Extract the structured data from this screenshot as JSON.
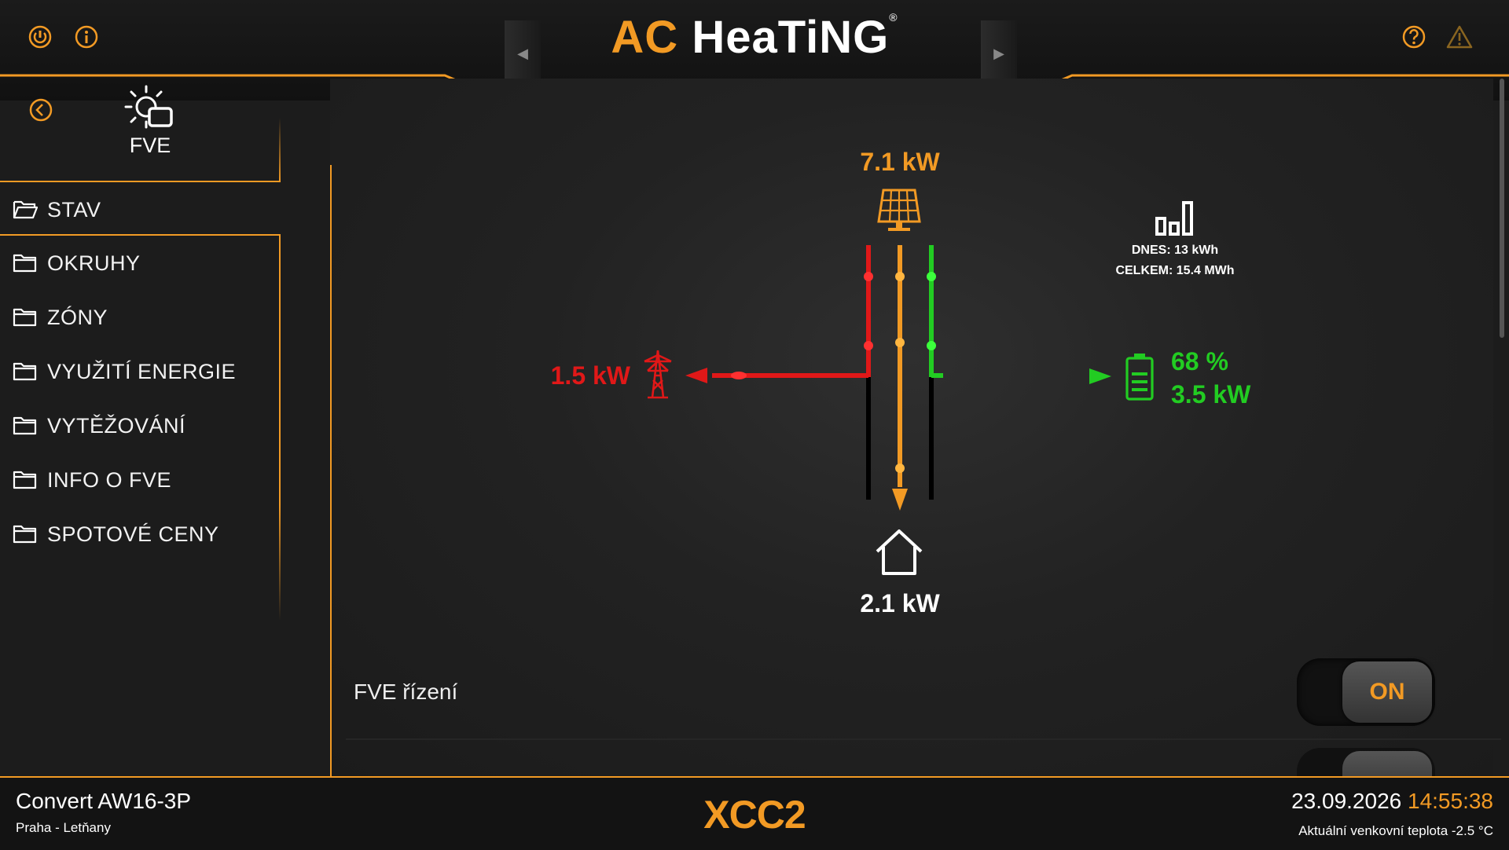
{
  "header": {
    "brand_ac": "AC",
    "brand_heating": "HeaTiNG",
    "brand_reg": "®",
    "prev_arrow": "◀",
    "next_arrow": "▶"
  },
  "sidebar": {
    "page_title": "FVE",
    "items": [
      {
        "label": "STAV"
      },
      {
        "label": "OKRUHY"
      },
      {
        "label": "ZÓNY"
      },
      {
        "label": "VYUŽITÍ ENERGIE"
      },
      {
        "label": "VYTĚŽOVÁNÍ"
      },
      {
        "label": "INFO O FVE"
      },
      {
        "label": "SPOTOVÉ CENY"
      }
    ]
  },
  "energy_flow": {
    "solar_power": "7.1 kW",
    "grid_power": "1.5 kW",
    "battery_percent": "68 %",
    "battery_power": "3.5 kW",
    "house_power": "2.1 kW",
    "stats_today": "DNES: 13 kWh",
    "stats_total": "CELKEM: 15.4 MWh"
  },
  "controls": {
    "fve_control_label": "FVE řízení",
    "fve_control_state": "ON"
  },
  "footer": {
    "model": "Convert AW16-3P",
    "location": "Praha - Letňany",
    "logo_xcc": "XCC",
    "logo_2": "2",
    "date": "23.09.2026",
    "time": "14:55:38",
    "outdoor_temp": "Aktuální venkovní teplota -2.5 °C"
  },
  "colors": {
    "accent": "#f29a24",
    "grid": "#e01818",
    "battery": "#22cc22",
    "background": "#1c1c1c"
  },
  "icons": [
    "power-icon",
    "info-icon",
    "help-icon",
    "warning-icon",
    "back-icon",
    "solar-settings-icon",
    "folder-icon",
    "solar-panel-icon",
    "pylon-icon",
    "battery-icon",
    "house-icon",
    "stats-icon"
  ]
}
